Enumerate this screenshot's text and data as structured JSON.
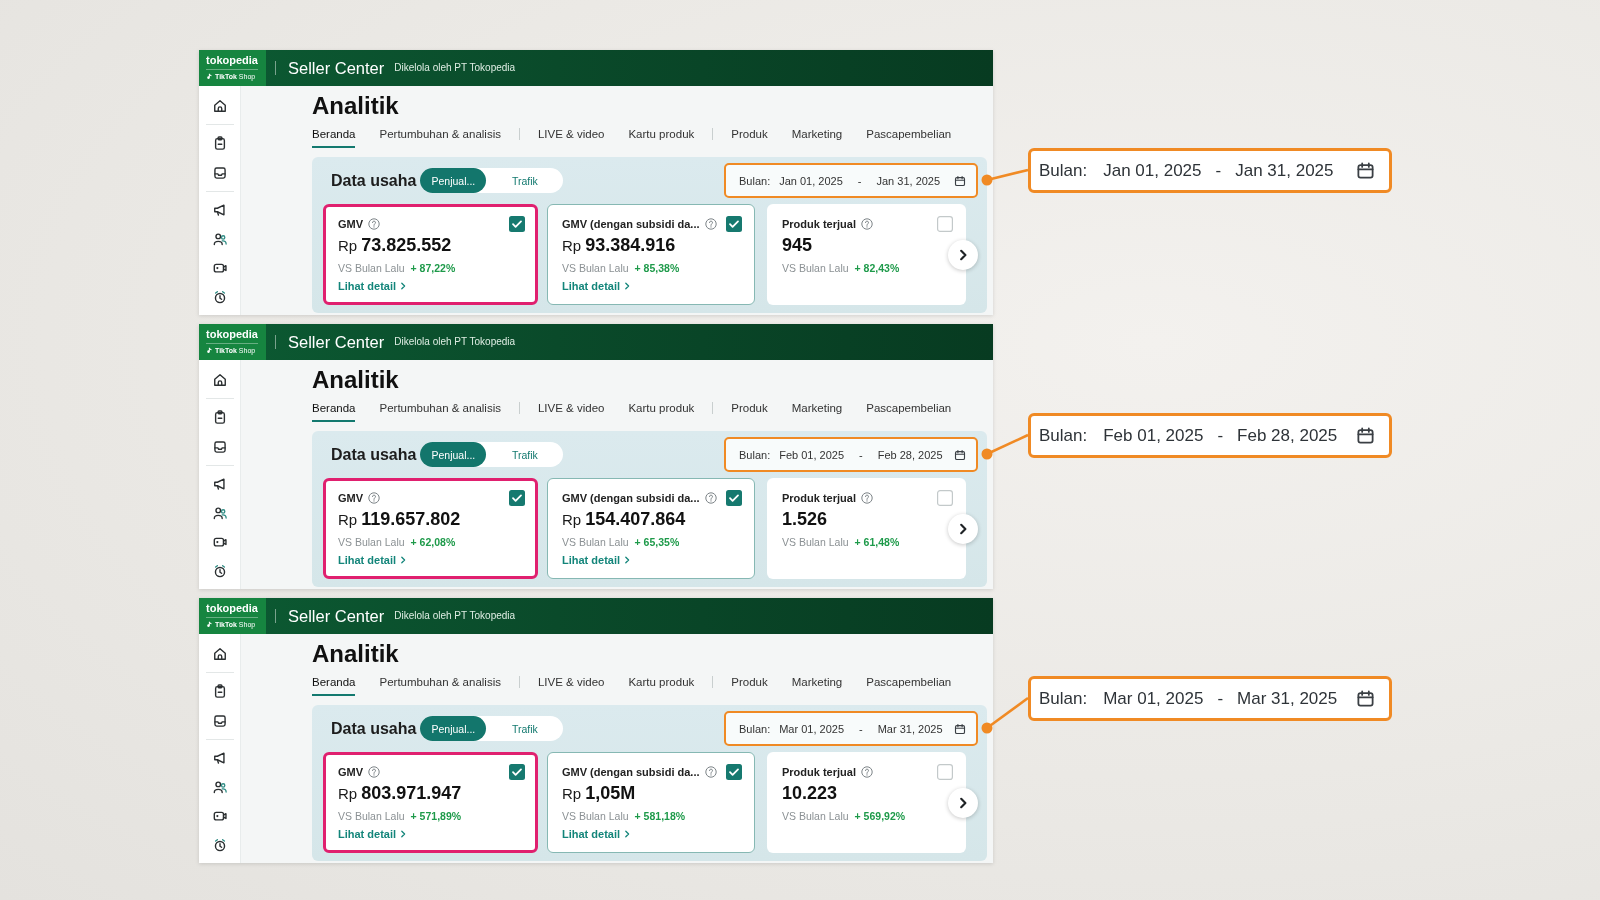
{
  "panels": [
    {
      "header": {
        "logo_text": "tokopedia",
        "logo_subtext": "**TikTok** Shop",
        "title": "Seller Center",
        "subtitle": "Dikelola oleh PT Tokopedia"
      },
      "page_title": "Analitik",
      "tab_groups": [
        {
          "tabs": [
            {
              "label": "Beranda",
              "selected": true
            },
            {
              "label": "Pertumbuhan & analisis",
              "selected": false
            }
          ]
        },
        {
          "tabs": [
            {
              "label": "LIVE & video",
              "selected": false
            },
            {
              "label": "Kartu produk",
              "selected": false
            }
          ]
        },
        {
          "tabs": [
            {
              "label": "Produk",
              "selected": false
            },
            {
              "label": "Marketing",
              "selected": false
            },
            {
              "label": "Pascapembelian",
              "selected": false
            }
          ]
        }
      ],
      "data_section": {
        "title": "Data usaha",
        "toggle": [
          {
            "label": "Penjual...",
            "selected": true
          },
          {
            "label": "Trafik",
            "selected": false
          }
        ],
        "date_range": {
          "label": "Bulan:",
          "start": "Jan 01, 2025",
          "separator": "-",
          "end": "Jan 31, 2025",
          "highlighted": true
        },
        "metrics": [
          {
            "name": "GMV",
            "currency": "Rp",
            "value": "73.825.552",
            "comparison": "VS Bulan Lalu",
            "change": "+ 87,22%",
            "link": "Lihat detail",
            "checked": true,
            "highlighted": true
          },
          {
            "name": "GMV (dengan subsidi da...",
            "currency": "Rp",
            "value": "93.384.916",
            "comparison": "VS Bulan Lalu",
            "change": "+ 85,38%",
            "link": "Lihat detail",
            "checked": true,
            "highlighted": false
          },
          {
            "name": "Produk terjual",
            "value": "945",
            "comparison": "VS Bulan Lalu",
            "change": "+ 82,43%",
            "checked": false,
            "highlighted": false
          }
        ]
      }
    },
    {
      "header": {
        "logo_text": "tokopedia",
        "logo_subtext": "**TikTok** Shop",
        "title": "Seller Center",
        "subtitle": "Dikelola oleh PT Tokopedia"
      },
      "page_title": "Analitik",
      "tab_groups": [
        {
          "tabs": [
            {
              "label": "Beranda",
              "selected": true
            },
            {
              "label": "Pertumbuhan & analisis",
              "selected": false
            }
          ]
        },
        {
          "tabs": [
            {
              "label": "LIVE & video",
              "selected": false
            },
            {
              "label": "Kartu produk",
              "selected": false
            }
          ]
        },
        {
          "tabs": [
            {
              "label": "Produk",
              "selected": false
            },
            {
              "label": "Marketing",
              "selected": false
            },
            {
              "label": "Pascapembelian",
              "selected": false
            }
          ]
        }
      ],
      "data_section": {
        "title": "Data usaha",
        "toggle": [
          {
            "label": "Penjual...",
            "selected": true
          },
          {
            "label": "Trafik",
            "selected": false
          }
        ],
        "date_range": {
          "label": "Bulan:",
          "start": "Feb 01, 2025",
          "separator": "-",
          "end": "Feb 28, 2025",
          "highlighted": true
        },
        "metrics": [
          {
            "name": "GMV",
            "currency": "Rp",
            "value": "119.657.802",
            "comparison": "VS Bulan Lalu",
            "change": "+ 62,08%",
            "link": "Lihat detail",
            "checked": true,
            "highlighted": true
          },
          {
            "name": "GMV (dengan subsidi da...",
            "currency": "Rp",
            "value": "154.407.864",
            "comparison": "VS Bulan Lalu",
            "change": "+ 65,35%",
            "link": "Lihat detail",
            "checked": true,
            "highlighted": false
          },
          {
            "name": "Produk terjual",
            "value": "1.526",
            "comparison": "VS Bulan Lalu",
            "change": "+ 61,48%",
            "checked": false,
            "highlighted": false
          }
        ]
      }
    },
    {
      "header": {
        "logo_text": "tokopedia",
        "logo_subtext": "**TikTok** Shop",
        "title": "Seller Center",
        "subtitle": "Dikelola oleh PT Tokopedia"
      },
      "page_title": "Analitik",
      "tab_groups": [
        {
          "tabs": [
            {
              "label": "Beranda",
              "selected": true
            },
            {
              "label": "Pertumbuhan & analisis",
              "selected": false
            }
          ]
        },
        {
          "tabs": [
            {
              "label": "LIVE & video",
              "selected": false
            },
            {
              "label": "Kartu produk",
              "selected": false
            }
          ]
        },
        {
          "tabs": [
            {
              "label": "Produk",
              "selected": false
            },
            {
              "label": "Marketing",
              "selected": false
            },
            {
              "label": "Pascapembelian",
              "selected": false
            }
          ]
        }
      ],
      "data_section": {
        "title": "Data usaha",
        "toggle": [
          {
            "label": "Penjual...",
            "selected": true
          },
          {
            "label": "Trafik",
            "selected": false
          }
        ],
        "date_range": {
          "label": "Bulan:",
          "start": "Mar 01, 2025",
          "separator": "-",
          "end": "Mar 31, 2025",
          "highlighted": true
        },
        "metrics": [
          {
            "name": "GMV",
            "currency": "Rp",
            "value": "803.971.947",
            "comparison": "VS Bulan Lalu",
            "change": "+ 571,89%",
            "link": "Lihat detail",
            "checked": true,
            "highlighted": true
          },
          {
            "name": "GMV (dengan subsidi da...",
            "currency": "Rp",
            "value": "1,05M",
            "comparison": "VS Bulan Lalu",
            "change": "+ 581,18%",
            "link": "Lihat detail",
            "checked": true,
            "highlighted": false
          },
          {
            "name": "Produk terjual",
            "value": "10.223",
            "comparison": "VS Bulan Lalu",
            "change": "+ 569,92%",
            "checked": false,
            "highlighted": false
          }
        ]
      }
    }
  ],
  "callouts": [
    {
      "label": "Bulan:",
      "start": "Jan 01, 2025",
      "separator": "-",
      "end": "Jan 31, 2025"
    },
    {
      "label": "Bulan:",
      "start": "Feb 01, 2025",
      "separator": "-",
      "end": "Feb 28, 2025"
    },
    {
      "label": "Bulan:",
      "start": "Mar 01, 2025",
      "separator": "-",
      "end": "Mar 31, 2025"
    }
  ]
}
